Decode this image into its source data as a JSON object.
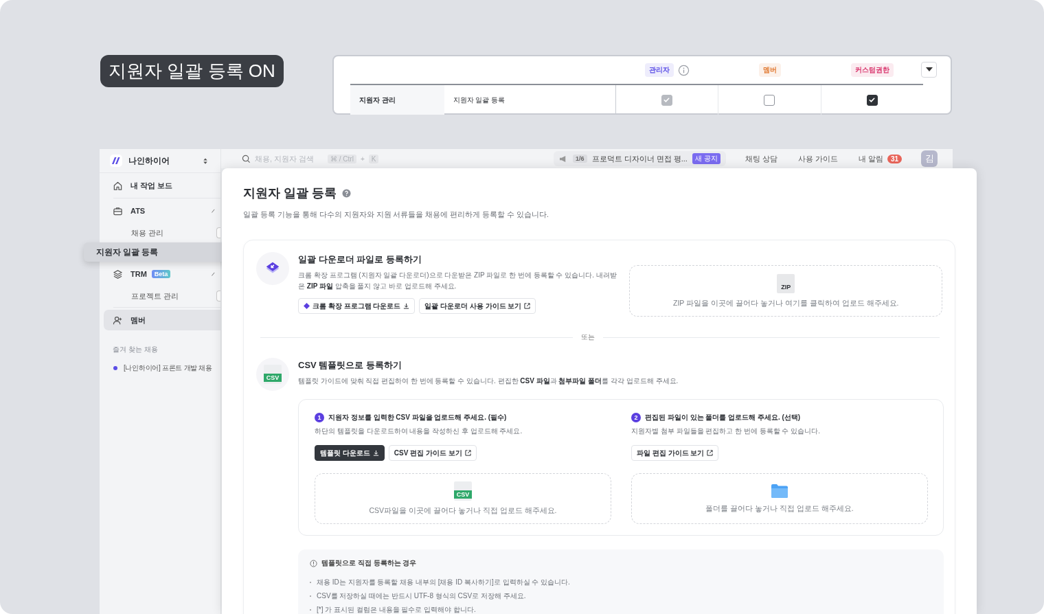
{
  "badge": {
    "label": "지원자 일괄 등록 ON"
  },
  "permissions": {
    "roles": [
      {
        "label": "관리자",
        "color": "#5b4ee6",
        "info": true
      },
      {
        "label": "멤버",
        "color": "#e0782f",
        "info": false
      },
      {
        "label": "커스텀권한",
        "color": "#d9376e",
        "info": false
      }
    ],
    "rows": [
      {
        "category": "지원자 관리",
        "feature": "지원자 일괄 등록",
        "checks": [
          {
            "checked": true,
            "disabled": true
          },
          {
            "checked": false,
            "disabled": false
          },
          {
            "checked": true,
            "disabled": false
          }
        ]
      }
    ]
  },
  "sidebar": {
    "workspace": "나인하이어",
    "items": [
      {
        "label": "내 작업 보드",
        "selected": false
      },
      {
        "label": "ATS",
        "selected": false,
        "expanded": true,
        "children": [
          {
            "label": "채용 관리",
            "selected": false
          },
          {
            "label": "지원자 일괄 등록",
            "selected": true
          }
        ]
      },
      {
        "label": "TRM",
        "selected": false,
        "expanded": true,
        "badge": "Beta",
        "children": [
          {
            "label": "프로젝트 관리",
            "selected": false
          }
        ]
      },
      {
        "label": "멤버",
        "selected": true
      }
    ],
    "favorites_title": "즐겨 찾는 채용",
    "favorites": [
      {
        "label": "[나인하이어] 프론트 개발 채용",
        "color": "#5b4ee6"
      }
    ]
  },
  "topbar": {
    "search": {
      "placeholder": "채용, 지원자 검색"
    },
    "shortcut": [
      "⌘ / Ctrl",
      "+",
      "K"
    ],
    "notice": {
      "counter": "1/6",
      "text": "프로덕트 디자이너 면접 평...",
      "tag": "새 공지"
    },
    "links": [
      "채팅 상담",
      "사용 가이드"
    ],
    "alerts": {
      "label": "내 알림",
      "count": "31"
    },
    "avatar": "김"
  },
  "modal": {
    "title": "지원자 일괄 등록",
    "description": "일괄 등록 기능을 통해 다수의 지원자와 지원 서류들을 채용에 편리하게 등록할 수 있습니다.",
    "zip_section": {
      "title": "일괄 다운로더 파일로 등록하기",
      "description": "크롬 확장 프로그램 (지원자 일괄 다운로더)으로 다운받은 ZIP 파일로 한 번에 등록할 수 있습니다. 내려받은 **ZIP 파일** 압축을 풀지 않고 바로 업로드해 주세요.",
      "buttons": [
        {
          "label": "크롬 확장 프로그램 다운로드",
          "kind": "download"
        },
        {
          "label": "일괄 다운로더 사용 가이드 보기",
          "kind": "link"
        }
      ],
      "dropzone": {
        "kind": "zip",
        "tag": "ZIP",
        "text": "ZIP 파일을 이곳에 끌어다 놓거나 여기를 클릭하여 업로드 해주세요."
      }
    },
    "separator": "또는",
    "csv_section": {
      "icon_tag": "CSV",
      "title": "CSV 템플릿으로 등록하기",
      "description": "템플릿 가이드에 맞춰 직접 편집하여 한 번에 등록할 수 있습니다. 편집한 **CSV 파일**과 **첨부파일 폴더**를 각각 업로드해 주세요.",
      "steps": [
        {
          "number": "1",
          "title": "지원자 정보를 입력한 CSV 파일을 업로드해 주세요. (필수)",
          "description": "하단의 템플릿을 다운로드하여 내용을 작성하신 후 업로드해 주세요.",
          "buttons": [
            {
              "label": "템플릿 다운로드",
              "kind": "primary"
            },
            {
              "label": "CSV 편집 가이드 보기",
              "kind": "link"
            }
          ],
          "dropzone": {
            "kind": "csv",
            "tag": "CSV",
            "text": "CSV파일을 이곳에 끌어다 놓거나 직접 업로드 해주세요."
          }
        },
        {
          "number": "2",
          "title": "편집된 파일이 있는 폴더를 업로드해 주세요. (선택)",
          "description": "지원자별 첨부 파일들을 편집하고 한 번에 등록할 수 있습니다.",
          "buttons": [
            {
              "label": "파일 편집 가이드 보기",
              "kind": "link"
            }
          ],
          "dropzone": {
            "kind": "folder",
            "text": "폴더를 끌어다 놓거나 직접 업로드 해주세요."
          }
        }
      ]
    },
    "notes": {
      "title": "템플릿으로 직접 등록하는 경우",
      "items": [
        "채용 ID는 지원자를 등록할 채용 내부의 [채용 ID 복사하기]로 입력하실 수 있습니다.",
        "CSV를 저장하실 때에는 반드시 UTF-8 형식의 CSV로 저장해 주세요.",
        "[*] 가 표시된 컬럼은 내용을 필수로 입력해야 합니다."
      ]
    }
  }
}
